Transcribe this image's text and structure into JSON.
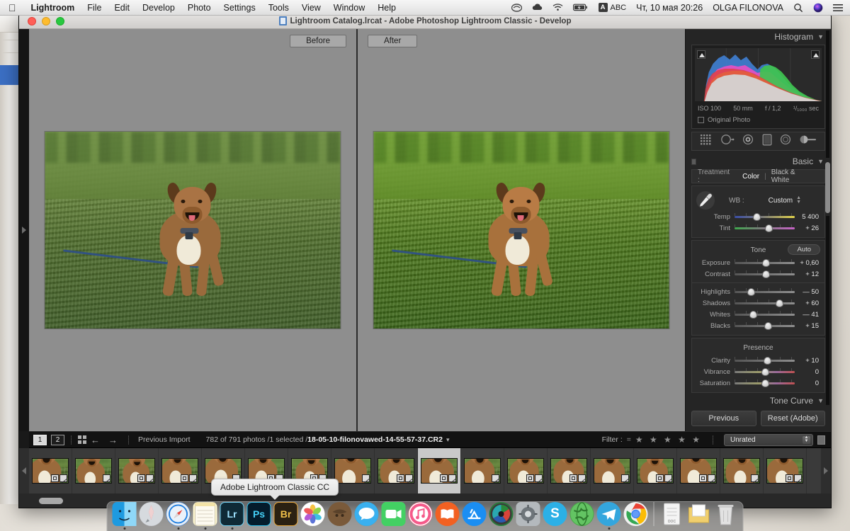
{
  "menubar": {
    "apple_icon": "apple-logo-icon",
    "app_name": "Lightroom",
    "items": [
      "File",
      "Edit",
      "Develop",
      "Photo",
      "Settings",
      "Tools",
      "View",
      "Window",
      "Help"
    ],
    "status": {
      "creative_cloud_icon": "creative-cloud-icon",
      "dropbox_icon": "cloud-icon",
      "wifi_icon": "wifi-icon",
      "battery_icon": "battery-charging-icon",
      "input_badge": "A",
      "input_label": "ABC",
      "datetime": "Чт, 10 мая  20:26",
      "user": "OLGA FILONOVA",
      "search_icon": "search-icon",
      "siri_icon": "siri-icon",
      "control_center_icon": "control-center-icon"
    }
  },
  "window": {
    "title": "Lightroom Catalog.lrcat - Adobe Photoshop Lightroom Classic - Develop",
    "close_label": "close",
    "minimize_label": "minimize",
    "zoom_label": "zoom"
  },
  "preview": {
    "before_label": "Before",
    "after_label": "After"
  },
  "right_panel": {
    "histogram": {
      "title": "Histogram",
      "iso": "ISO 100",
      "focal": "50 mm",
      "aperture": "f / 1,2",
      "shutter": "¹/₁₀₀₀ sec",
      "original_photo": "Original Photo"
    },
    "tools": [
      {
        "name": "crop-overlay-tool"
      },
      {
        "name": "spot-removal-tool"
      },
      {
        "name": "red-eye-correction-tool"
      },
      {
        "name": "graduated-filter-tool"
      },
      {
        "name": "radial-filter-tool"
      },
      {
        "name": "adjustment-brush-tool"
      }
    ],
    "basic": {
      "title": "Basic",
      "treatment_label": "Treatment :",
      "treatment_color": "Color",
      "treatment_bw": "Black & White",
      "wb_label": "WB :",
      "wb_value": "Custom",
      "wb_sliders": [
        {
          "name": "Temp",
          "value": "5 400",
          "pos": 37
        },
        {
          "name": "Tint",
          "value": "+ 26",
          "pos": 56
        }
      ],
      "tone_title": "Tone",
      "auto_label": "Auto",
      "tone_sliders": [
        {
          "name": "Exposure",
          "value": "+ 0,60",
          "pos": 52
        },
        {
          "name": "Contrast",
          "value": "+ 12",
          "pos": 52
        }
      ],
      "tone_sliders2": [
        {
          "name": "Highlights",
          "value": "— 50",
          "pos": 27
        },
        {
          "name": "Shadows",
          "value": "+ 60",
          "pos": 74
        },
        {
          "name": "Whites",
          "value": "— 41",
          "pos": 31
        },
        {
          "name": "Blacks",
          "value": "+ 15",
          "pos": 55
        }
      ],
      "presence_title": "Presence",
      "presence_sliders": [
        {
          "name": "Clarity",
          "value": "+ 10",
          "pos": 54
        },
        {
          "name": "Vibrance",
          "value": "0",
          "pos": 50
        },
        {
          "name": "Saturation",
          "value": "0",
          "pos": 50
        }
      ]
    },
    "tone_curve": {
      "title": "Tone Curve"
    },
    "buttons": {
      "previous": "Previous",
      "reset": "Reset (Adobe)"
    }
  },
  "toolbar": {
    "view1": "1",
    "view2": "2",
    "grid_icon": "grid-view-icon",
    "prev_icon": "arrow-left-icon",
    "next_icon": "arrow-right-icon",
    "source": "Previous Import",
    "count": "782 of 791 photos /1 selected /",
    "filename": "18-05-10-filonovawed-14-55-57-37.CR2",
    "filter_label": "Filter :",
    "filter_stars": "★ ★ ★ ★ ★",
    "filter_equals": "=",
    "filter_value": "Unrated"
  },
  "filmstrip": {
    "left_arrow_icon": "arrow-left-icon",
    "right_arrow_icon": "arrow-right-icon",
    "selected_index": 9,
    "thumbnails": [
      {
        "id": "thumb-1"
      },
      {
        "id": "thumb-2"
      },
      {
        "id": "thumb-3"
      },
      {
        "id": "thumb-4"
      },
      {
        "id": "thumb-5"
      },
      {
        "id": "thumb-6"
      },
      {
        "id": "thumb-7"
      },
      {
        "id": "thumb-8"
      },
      {
        "id": "thumb-9"
      },
      {
        "id": "thumb-10"
      },
      {
        "id": "thumb-11"
      },
      {
        "id": "thumb-12"
      },
      {
        "id": "thumb-13"
      },
      {
        "id": "thumb-14"
      },
      {
        "id": "thumb-15"
      },
      {
        "id": "thumb-16"
      },
      {
        "id": "thumb-17"
      },
      {
        "id": "thumb-18"
      }
    ]
  },
  "tooltip": {
    "text": "Adobe Lightroom Classic CC"
  },
  "dock": {
    "items": [
      {
        "name": "finder-icon",
        "label": "",
        "color": "#2d9cdb",
        "running": true
      },
      {
        "name": "launchpad-icon",
        "label": "",
        "color": "#c8cdd2",
        "running": false
      },
      {
        "name": "safari-icon",
        "label": "",
        "color": "#2f7fe0",
        "running": true
      },
      {
        "name": "notes-icon",
        "label": "",
        "color": "#fdf6d0",
        "running": true
      },
      {
        "name": "lightroom-icon",
        "label": "Lr",
        "color": "#0f2a36",
        "running": true
      },
      {
        "name": "photoshop-icon",
        "label": "Ps",
        "color": "#041c2c",
        "running": false
      },
      {
        "name": "bridge-icon",
        "label": "Br",
        "color": "#2b2112",
        "running": false
      },
      {
        "name": "photos-icon",
        "label": "",
        "color": "#ffffff",
        "running": false
      },
      {
        "name": "coconutbattery-icon",
        "label": "",
        "color": "#7a5a3a",
        "running": false
      },
      {
        "name": "messages-icon",
        "label": "",
        "color": "#34aadc",
        "running": false
      },
      {
        "name": "facetime-icon",
        "label": "",
        "color": "#4cd964",
        "running": false
      },
      {
        "name": "itunes-icon",
        "label": "",
        "color": "#fc4f72",
        "running": false
      },
      {
        "name": "books-icon",
        "label": "",
        "color": "#f26122",
        "running": false
      },
      {
        "name": "appstore-icon",
        "label": "",
        "color": "#1b8ef2",
        "running": false
      },
      {
        "name": "capture-one-icon",
        "label": "",
        "color": "#2a7a3a",
        "running": false
      },
      {
        "name": "system-preferences-icon",
        "label": "",
        "color": "#9b9b9b",
        "running": false
      },
      {
        "name": "skype-icon",
        "label": "S",
        "color": "#2cb0e6",
        "running": false
      },
      {
        "name": "green-globe-icon",
        "label": "",
        "color": "#4aa84a",
        "running": false
      },
      {
        "name": "telegram-icon",
        "label": "",
        "color": "#36a8e0",
        "running": true
      },
      {
        "name": "chrome-icon",
        "label": "",
        "color": "#f4f4f4",
        "running": false
      }
    ],
    "trash_items": [
      {
        "name": "documents-stack-icon",
        "color": "#efefef"
      },
      {
        "name": "downloads-folder-icon",
        "color": "#f2d98a"
      },
      {
        "name": "trash-icon",
        "color": "#dcdcdc"
      }
    ]
  },
  "colors": {
    "panel_bg": "#252525",
    "preview_bg": "#8e8e8e",
    "accent": "#4a90d9"
  }
}
